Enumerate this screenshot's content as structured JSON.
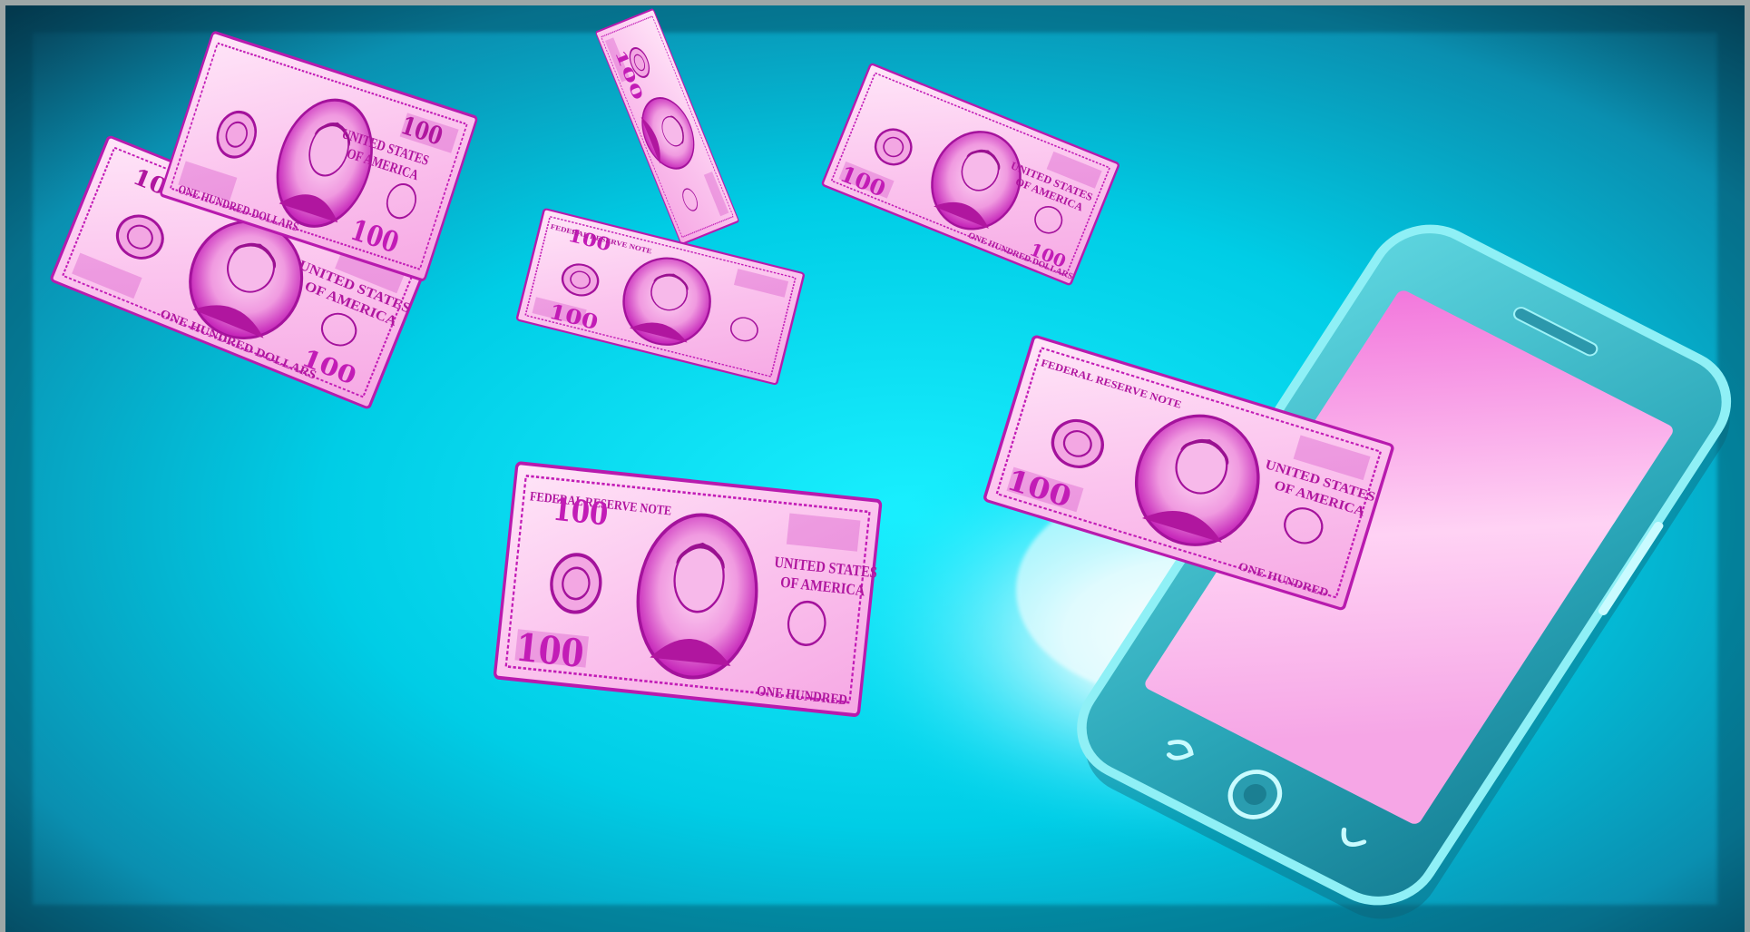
{
  "scene": {
    "description_free": true,
    "colors": {
      "frame": "#f4e6dc",
      "sky_center": "#00e1f5",
      "sky_mid": "#00b8d6",
      "sky_edge": "#063c52",
      "glow": "#ffffff",
      "bill_paper": "#fbc9f0",
      "bill_paper_light": "#ffe3f8",
      "bill_ink": "#c21cb6",
      "bill_ink_dark": "#8e0f86",
      "phone_body": "#3cb8c8",
      "phone_edge": "#8ff0f6",
      "phone_screen": "#f48fe0",
      "phone_screen_light": "#ffd9f6"
    },
    "icons": [
      "hundred-dollar-bill",
      "smartphone",
      "home-button-icon",
      "back-button-icon",
      "menu-button-icon"
    ]
  },
  "bills": {
    "denomination": "100",
    "country_line_1": "UNITED STATES",
    "country_line_2": "OF AMERICA",
    "reserve": "FEDERAL RESERVE NOTE",
    "amount_words": "ONE HUNDRED DOLLARS",
    "amount_words_short": "ONE HUNDRED"
  }
}
